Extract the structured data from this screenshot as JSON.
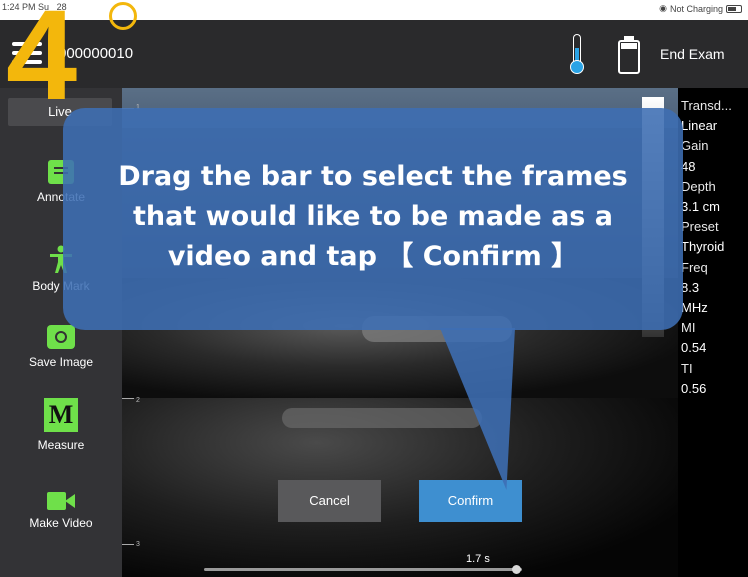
{
  "status_bar": {
    "time": "1:24 PM",
    "date_partial": "Su",
    "date_day": "28",
    "charging": "Not Charging"
  },
  "header": {
    "patient_id": "000000010",
    "end_exam_label": "End Exam",
    "thermometer_icon": "thermometer-icon",
    "battery_icon": "battery-icon"
  },
  "sidebar": {
    "live_label": "Live",
    "tools": [
      {
        "label": "Annotate",
        "icon": "annotate-icon"
      },
      {
        "label": "Body Mark",
        "icon": "body-mark-icon"
      },
      {
        "label": "Save Image",
        "icon": "camera-icon"
      },
      {
        "label": "Measure",
        "icon": "measure-icon",
        "glyph": "M"
      },
      {
        "label": "Make Video",
        "icon": "video-icon"
      }
    ]
  },
  "scan_info": {
    "transducer_label": "Transd...",
    "transducer_value": "Linear",
    "gain_label": "Gain",
    "gain_value": "48",
    "depth_label": "Depth",
    "depth_value": "3.1 cm",
    "preset_label": "Preset",
    "preset_value": "Thyroid",
    "freq_label": "Freq",
    "freq_value": "8.3",
    "freq_unit": "MHz",
    "mi_label": "MI",
    "mi_value": "0.54",
    "ti_label": "TI",
    "ti_value": "0.56"
  },
  "depth_ticks": [
    "1",
    "2",
    "3"
  ],
  "tutorial": {
    "step_number": "4",
    "line1": "Drag the bar to select the frames",
    "line2": "that would like to be made as a",
    "line3": "video and tap 【 Confirm 】"
  },
  "actions": {
    "cancel_label": "Cancel",
    "confirm_label": "Confirm"
  },
  "timeline": {
    "time_label": "1.7 s",
    "position_fraction": 0.98
  },
  "colors": {
    "accent_green": "#6fe04a",
    "step_orange": "#f3b70c",
    "confirm_blue": "#3e8fd0",
    "callout_blue": "#3e6eb4"
  }
}
